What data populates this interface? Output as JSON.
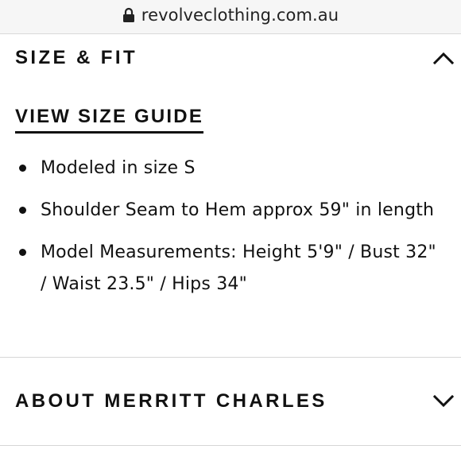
{
  "browser": {
    "url": "revolveclothing.com.au",
    "lock_icon": "lock-icon"
  },
  "size_fit": {
    "title": "SIZE & FIT",
    "expanded": true,
    "toggle_icon": "chevron-up-icon",
    "size_guide_label": "VIEW SIZE GUIDE",
    "bullets": [
      "Modeled in size S",
      "Shoulder Seam to Hem approx 59\" in length",
      "Model Measurements: Height 5'9\" / Bust 32\" / Waist 23.5\" / Hips 34\""
    ]
  },
  "about": {
    "title": "ABOUT MERRITT CHARLES",
    "expanded": false,
    "toggle_icon": "chevron-down-icon"
  },
  "colors": {
    "text": "#111111",
    "url_bar_bg": "#f6f6f6",
    "divider": "#d6d6d6"
  }
}
